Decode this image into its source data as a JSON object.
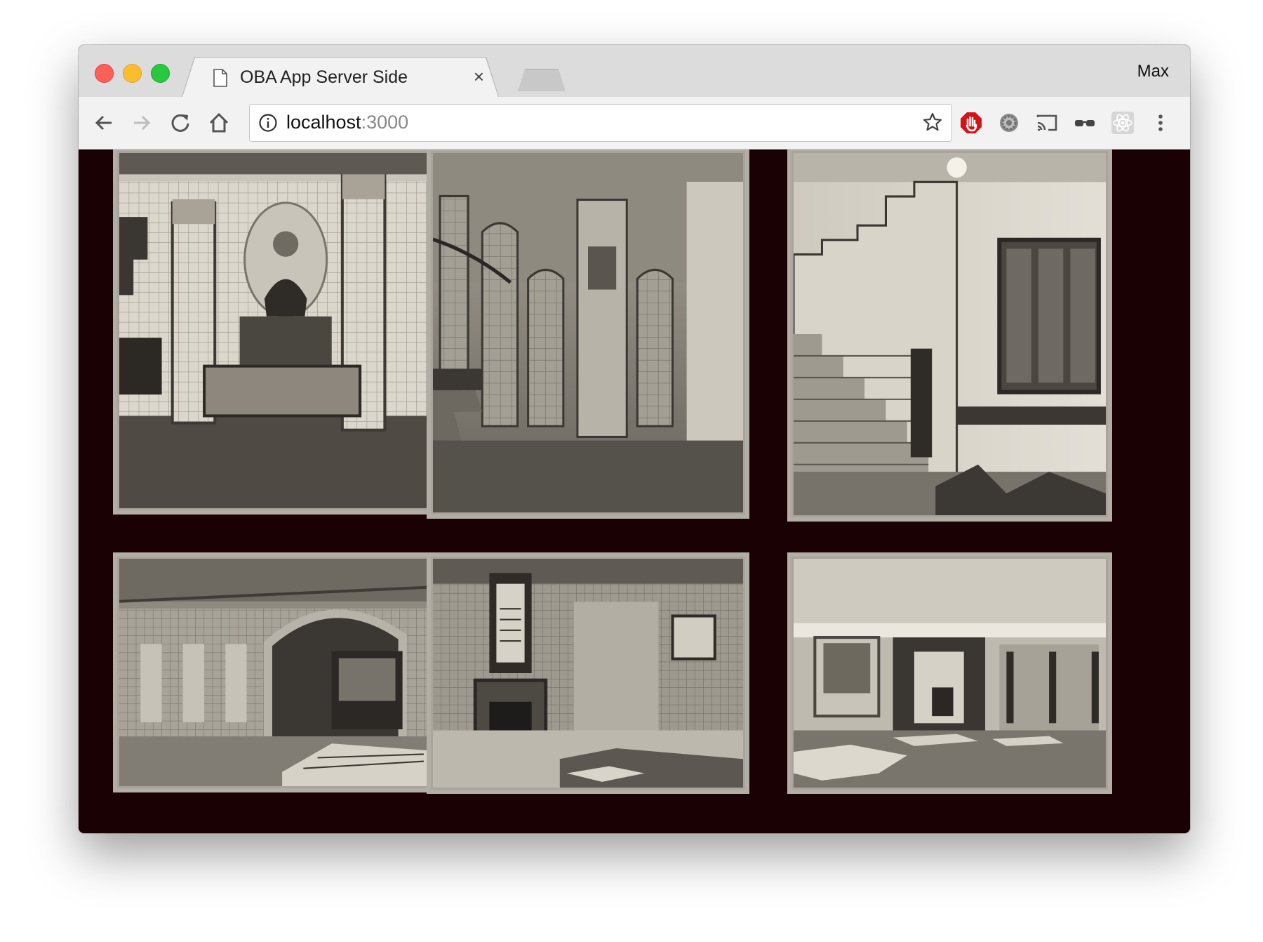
{
  "browser": {
    "tab_title": "OBA App Server Side",
    "tab_close": "×",
    "profile_name": "Max",
    "url_host": "localhost",
    "url_port": ":3000",
    "icons": [
      "back-icon",
      "forward-icon",
      "reload-icon",
      "home-icon",
      "info-icon",
      "bookmark-star-icon",
      "adblock-extension-icon",
      "settings-extension-icon",
      "cast-icon",
      "glasses-extension-icon",
      "react-devtools-icon",
      "menu-dots-icon"
    ]
  },
  "gallery": {
    "background": "#1a0104",
    "photos": [
      {
        "subject": "tiled fireplace alcove with saint portrait"
      },
      {
        "subject": "tiled stairwell with arched niches"
      },
      {
        "subject": "staircase hall with window"
      },
      {
        "subject": "tiled hallway with archway"
      },
      {
        "subject": "tiled room with fireplace"
      },
      {
        "subject": "tiled room with bench"
      }
    ]
  }
}
